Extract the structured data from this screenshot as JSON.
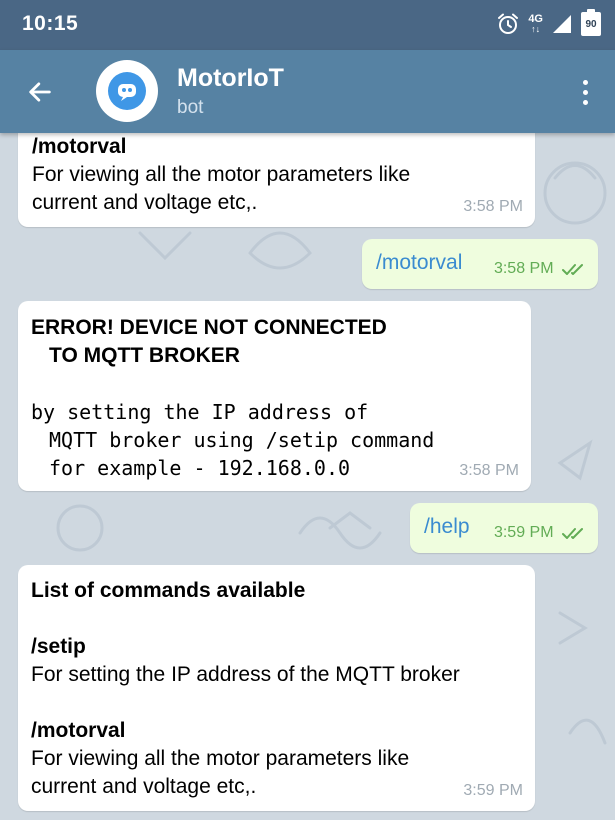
{
  "status": {
    "time": "10:15",
    "network_top": "4G",
    "network_bottom": "↑↓",
    "battery": "90"
  },
  "header": {
    "title": "MotorIoT",
    "subtitle": "bot"
  },
  "messages": [
    {
      "type": "incoming",
      "lines": [
        "/motorval",
        "For viewing all the motor parameters like",
        "current and voltage etc,."
      ],
      "time": "3:58 PM"
    },
    {
      "type": "outgoing",
      "text": "/motorval",
      "time": "3:58 PM"
    },
    {
      "type": "incoming",
      "lines": [
        "ERROR! DEVICE NOT CONNECTED",
        "TO MQTT BROKER",
        "by setting the IP address of",
        "MQTT broker using /setip command",
        "for example - 192.168.0.0"
      ],
      "time": "3:58 PM"
    },
    {
      "type": "outgoing",
      "text": "/help",
      "time": "3:59 PM"
    },
    {
      "type": "incoming",
      "lines": [
        "List of commands available",
        "/setip",
        "For setting the IP address of the MQTT broker",
        "/motorval",
        "For viewing all the motor parameters like",
        "current and voltage etc,."
      ],
      "time": "3:59 PM"
    }
  ]
}
